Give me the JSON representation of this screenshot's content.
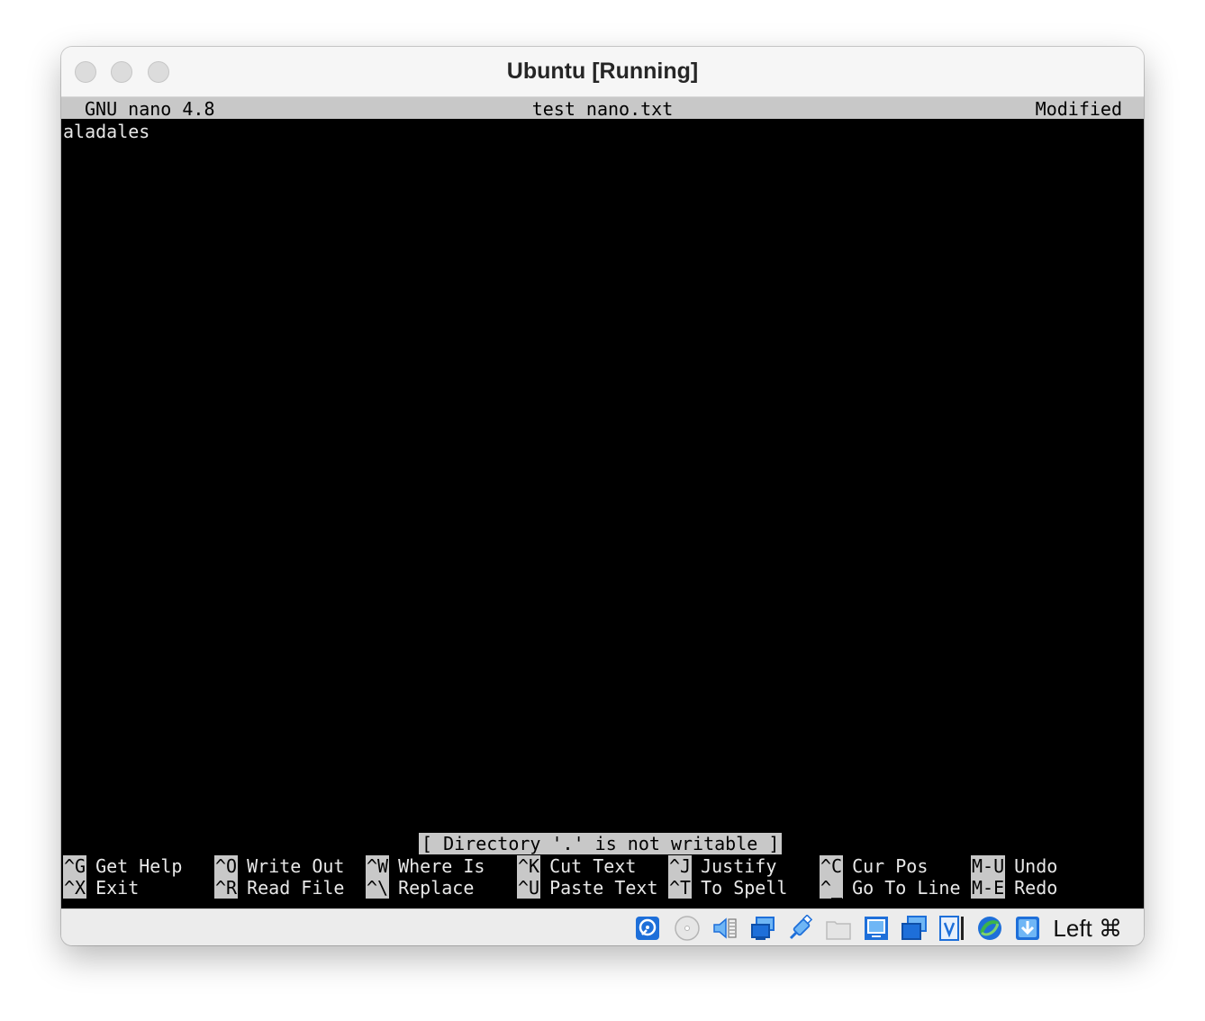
{
  "window": {
    "title": "Ubuntu [Running]"
  },
  "nano": {
    "header": {
      "version": "GNU nano 4.8",
      "filename": "test_nano.txt",
      "state": "Modified"
    },
    "content": [
      "aladales"
    ],
    "status_message": "[ Directory '.' is not writable ]",
    "shortcuts_row1": [
      {
        "key": "^G",
        "label": "Get Help"
      },
      {
        "key": "^O",
        "label": "Write Out"
      },
      {
        "key": "^W",
        "label": "Where Is"
      },
      {
        "key": "^K",
        "label": "Cut Text"
      },
      {
        "key": "^J",
        "label": "Justify"
      },
      {
        "key": "^C",
        "label": "Cur Pos"
      },
      {
        "key": "M-U",
        "label": "Undo"
      }
    ],
    "shortcuts_row2": [
      {
        "key": "^X",
        "label": "Exit"
      },
      {
        "key": "^R",
        "label": "Read File"
      },
      {
        "key": "^\\",
        "label": "Replace"
      },
      {
        "key": "^U",
        "label": "Paste Text"
      },
      {
        "key": "^T",
        "label": "To Spell"
      },
      {
        "key": "^_",
        "label": "Go To Line"
      },
      {
        "key": "M-E",
        "label": "Redo"
      }
    ]
  },
  "vm_statusbar": {
    "icons": [
      "hard-disk-icon",
      "optical-drive-icon",
      "audio-icon",
      "network-icon",
      "usb-icon",
      "shared-folders-icon",
      "display-icon",
      "video-capture-icon",
      "virtualization-icon",
      "mouse-integration-icon",
      "keyboard-capture-icon"
    ],
    "host_key": "Left ⌘",
    "colors": {
      "accent_blue": "#1e6fd9",
      "light_blue": "#6fb6f5",
      "green": "#3cb44b"
    }
  }
}
